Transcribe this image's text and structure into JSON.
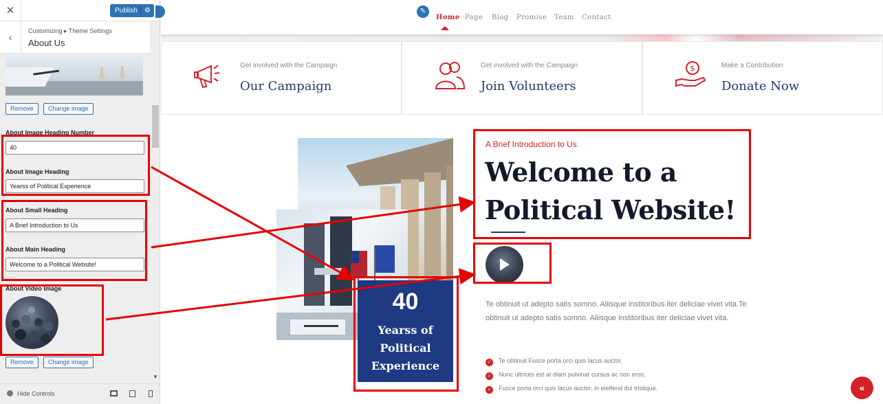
{
  "customizer": {
    "close_glyph": "✕",
    "publish_label": "Publish",
    "gear_glyph": "⚙",
    "back_glyph": "‹",
    "breadcrumb": "Customizing ▸ Theme Settings",
    "section_title": "About Us",
    "image_buttons": {
      "remove": "Remove",
      "change": "Change image"
    },
    "fields": {
      "heading_number": {
        "label": "About Image Heading Number",
        "value": "40"
      },
      "image_heading": {
        "label": "About Image Heading",
        "value": "Yearss of Political Experience"
      },
      "small_heading": {
        "label": "About Small Heading",
        "value": "A Brief Introduction to Us"
      },
      "main_heading": {
        "label": "About Main Heading",
        "value": "Welcome to a Political Website!"
      },
      "video_image": {
        "label": "About Video Image"
      }
    },
    "video_buttons": {
      "remove": "Remove",
      "change": "Change image"
    },
    "footer": {
      "hide_controls": "Hide Controls"
    }
  },
  "site": {
    "nav": {
      "items": [
        {
          "label": "Home",
          "active": true
        },
        {
          "label": "Page"
        },
        {
          "label": "Blog"
        },
        {
          "label": "Promise"
        },
        {
          "label": "Team"
        },
        {
          "label": "Contact"
        }
      ]
    },
    "features": [
      {
        "small": "Get involved with the Campaign",
        "big": "Our Campaign",
        "icon": "megaphone-icon"
      },
      {
        "small": "Get involved with the Campaign",
        "big": "Join Volunteers",
        "icon": "people-icon"
      },
      {
        "small": "Make a Contribution",
        "big": "Donate Now",
        "icon": "donate-hand-icon"
      }
    ],
    "about": {
      "exp_number": "40",
      "exp_text": "Yearss of Political Experience",
      "small_heading": "A Brief Introduction to Us",
      "main_heading": "Welcome to a Political Website!",
      "paragraph": "Te obtinuit ut adepto satis somno. Aliisque institoribus iter deliciae vivet vita.Te obtinuit ut adepto satis somno. Aliisque institoribus iter deliciae vivet vita.",
      "checklist": [
        "Te obtinuit Fusce porta orci quis lacus auctor.",
        "Nunc ultrices est at diam pulvinar cursus ac non eros.",
        "Fusce porta orci quis lacus auctor, in eleifend dui tristique."
      ]
    },
    "scroll_top_glyph": "«"
  },
  "colors": {
    "accent_red": "#d4212a",
    "navy": "#1d3a6b",
    "wp_blue": "#2b73b5",
    "annotation_red": "#e60000"
  }
}
